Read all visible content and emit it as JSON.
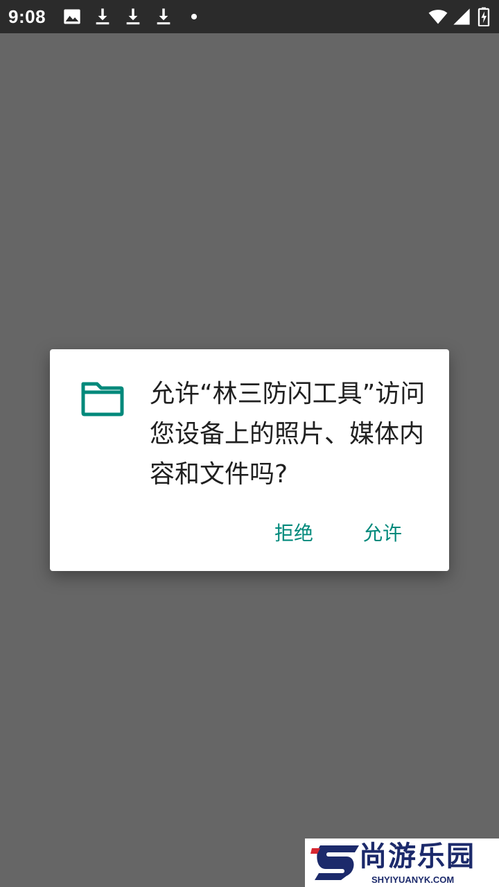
{
  "status_bar": {
    "time": "9:08",
    "icons_left": [
      "image-icon",
      "download-icon",
      "download-icon",
      "download-icon",
      "dot-icon"
    ],
    "icons_right": [
      "wifi-icon",
      "signal-icon",
      "battery-charging-icon"
    ]
  },
  "dialog": {
    "icon": "folder-icon",
    "message": "允许“林三防闪工具”访问您设备上的照片、媒体内容和文件吗?",
    "deny_label": "拒绝",
    "allow_label": "允许",
    "accent_color": "#00897b"
  },
  "watermark": {
    "text": "尚游乐园",
    "url": "SHYIYUANYK.COM"
  }
}
